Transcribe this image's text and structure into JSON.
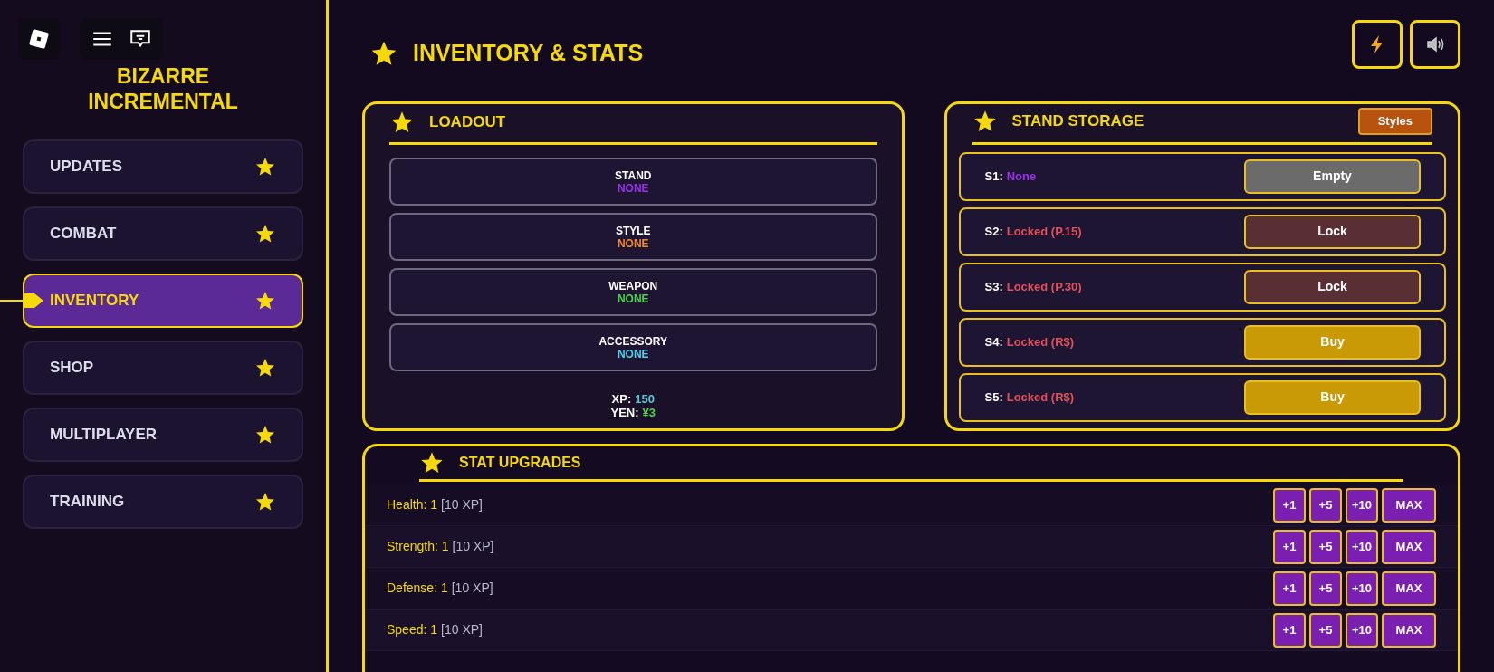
{
  "game_title": [
    "BIZARRE",
    "INCREMENTAL"
  ],
  "sidebar": {
    "items": [
      {
        "label": "UPDATES",
        "selected": false
      },
      {
        "label": "COMBAT",
        "selected": false
      },
      {
        "label": "INVENTORY",
        "selected": true
      },
      {
        "label": "SHOP",
        "selected": false
      },
      {
        "label": "MULTIPLAYER",
        "selected": false
      },
      {
        "label": "TRAINING",
        "selected": false
      }
    ]
  },
  "page_title": "INVENTORY & STATS",
  "loadout": {
    "title": "LOADOUT",
    "slots": [
      {
        "label": "STAND",
        "value": "NONE",
        "color": "#9b30e8"
      },
      {
        "label": "STYLE",
        "value": "NONE",
        "color": "#f0892a"
      },
      {
        "label": "WEAPON",
        "value": "NONE",
        "color": "#4bd44b"
      },
      {
        "label": "ACCESSORY",
        "value": "NONE",
        "color": "#4fd0e8"
      }
    ],
    "stats": [
      {
        "label": "XP:",
        "value": "150",
        "color": "#5cc7d6"
      },
      {
        "label": "YEN:",
        "value": "¥3",
        "color": "#4bd44b"
      }
    ]
  },
  "stand_storage": {
    "title": "STAND STORAGE",
    "styles_button": "Styles",
    "slots": [
      {
        "label": "S1:",
        "status": "None",
        "color": "#9b30e8",
        "button": "Empty",
        "kind": "empty"
      },
      {
        "label": "S2:",
        "status": "Locked (P.15)",
        "color": "#e0505a",
        "button": "Lock",
        "kind": "lock"
      },
      {
        "label": "S3:",
        "status": "Locked (P.30)",
        "color": "#e0505a",
        "button": "Lock",
        "kind": "lock"
      },
      {
        "label": "S4:",
        "status": "Locked (R$)",
        "color": "#e0505a",
        "button": "Buy",
        "kind": "buy"
      },
      {
        "label": "S5:",
        "status": "Locked (R$)",
        "color": "#e0505a",
        "button": "Buy",
        "kind": "buy"
      }
    ]
  },
  "stat_upgrades": {
    "title": "STAT UPGRADES",
    "rows": [
      {
        "name": "Health: 1",
        "cost": "[10 XP]",
        "buttons": [
          "+1",
          "+5",
          "+10",
          "MAX"
        ]
      },
      {
        "name": "Strength: 1",
        "cost": "[10 XP]",
        "buttons": [
          "+1",
          "+5",
          "+10",
          "MAX"
        ]
      },
      {
        "name": "Defense: 1",
        "cost": "[10 XP]",
        "buttons": [
          "+1",
          "+5",
          "+10",
          "MAX"
        ]
      },
      {
        "name": "Speed: 1",
        "cost": "[10 XP]",
        "buttons": [
          "+1",
          "+5",
          "+10",
          "MAX"
        ]
      }
    ]
  }
}
